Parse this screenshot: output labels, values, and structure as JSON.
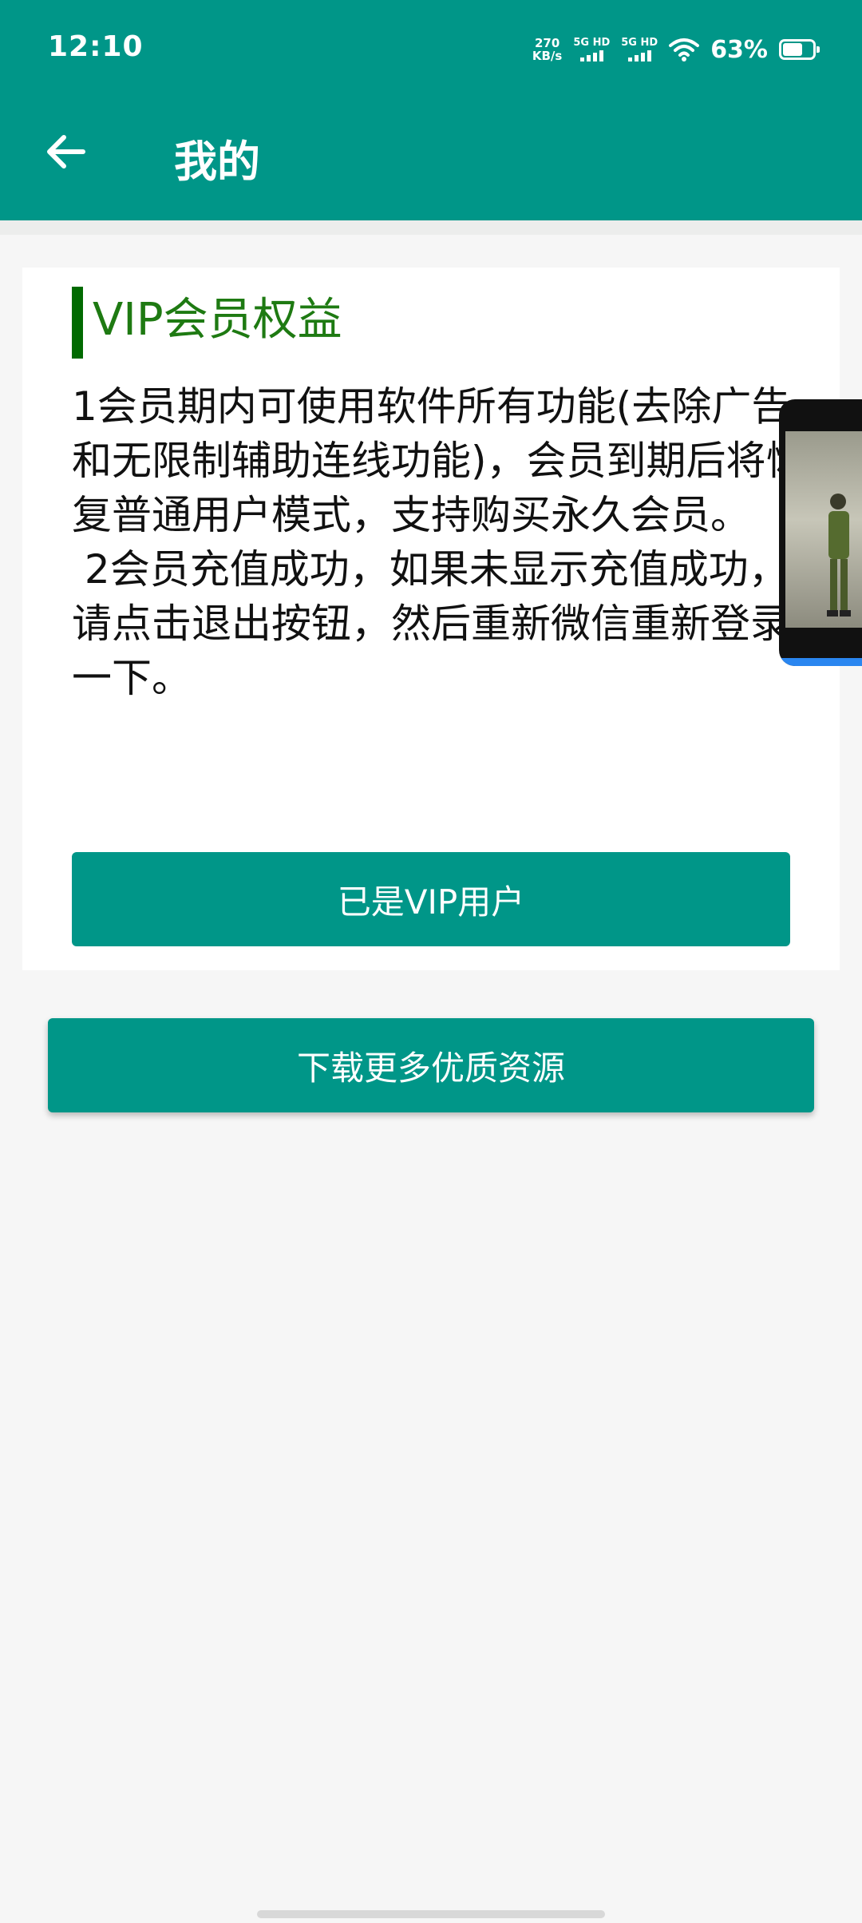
{
  "status_bar": {
    "time": "12:10",
    "net_speed_value": "270",
    "net_speed_unit": "KB/s",
    "sim1_label": "5G HD",
    "sim2_label": "5G HD",
    "battery_percent": "63%",
    "battery_level": 0.63,
    "icons": [
      "wifi-icon",
      "signal-icon",
      "battery-icon"
    ]
  },
  "app_bar": {
    "title": "我的",
    "back_icon": "arrow-left-icon"
  },
  "vip_card": {
    "title": "VIP会员权益",
    "body": "1会员期内可使用软件所有功能(去除广告和无限制辅助连线功能)，会员到期后将恢复普通用户模式，支持购买永久会员。\n 2会员充值成功，如果未显示充值成功，请点击退出按钮，然后重新微信重新登录一下。",
    "button_label": "已是VIP用户"
  },
  "download_button": {
    "label": "下载更多优质资源"
  },
  "floating_video": {
    "icon": "video-thumbnail"
  },
  "colors": {
    "primary": "#009688",
    "title_accent": "#006a00",
    "title_text": "#1e7a12",
    "background": "#f6f6f6"
  }
}
